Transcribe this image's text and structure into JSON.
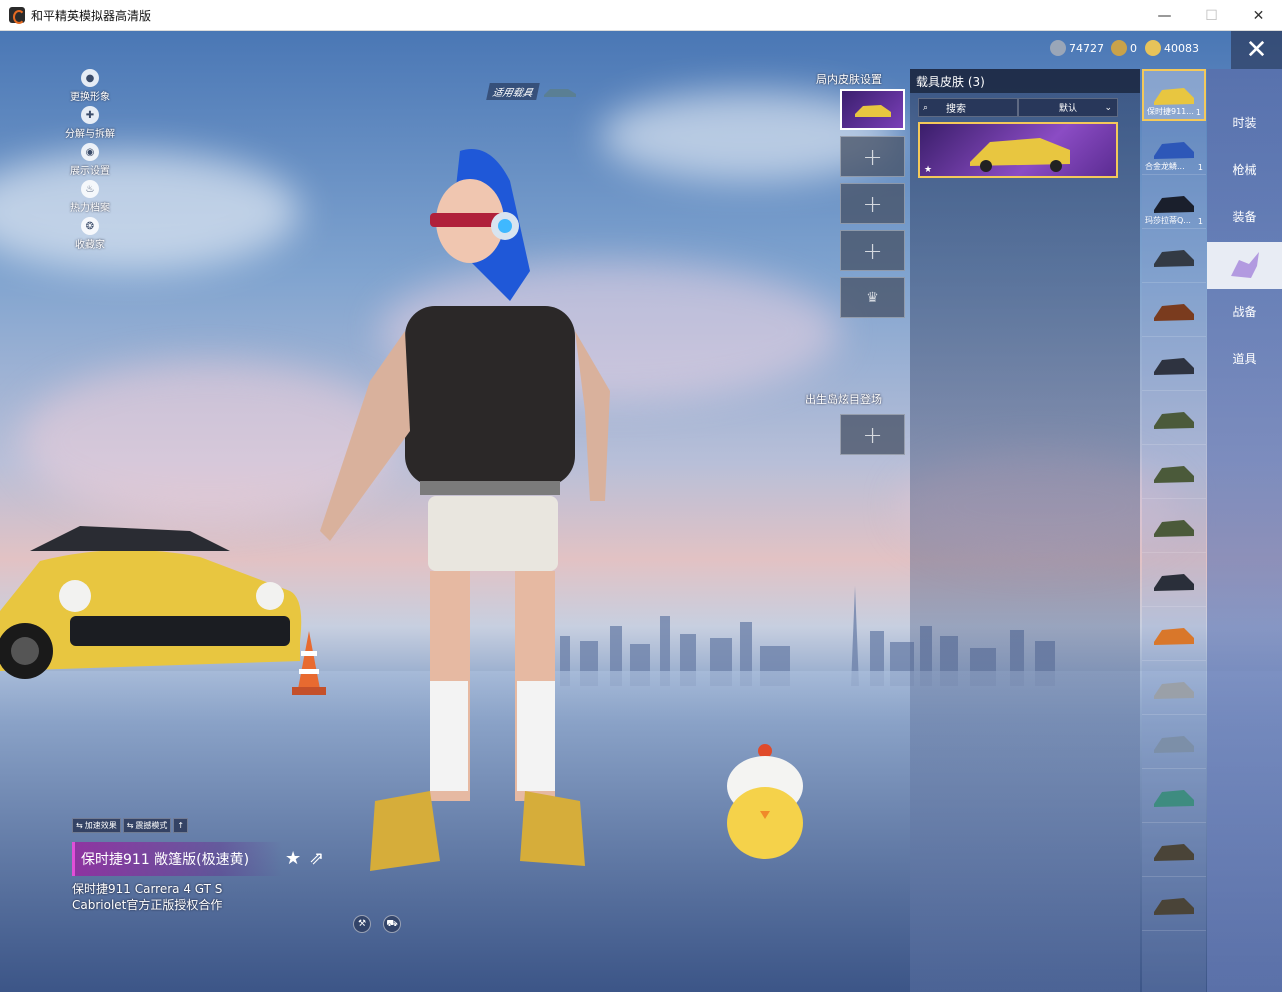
{
  "window": {
    "title": "和平精英模拟器高清版",
    "minimize": "—",
    "maximize": "☐",
    "close": "✕"
  },
  "left_menu": [
    {
      "label": "更换形象",
      "icon": "person-icon",
      "glyph": "●"
    },
    {
      "label": "分解与拆解",
      "icon": "puzzle-icon",
      "glyph": "✚"
    },
    {
      "label": "展示设置",
      "icon": "eye-icon",
      "glyph": "◉"
    },
    {
      "label": "热力档案",
      "icon": "flame-icon",
      "glyph": "♨"
    },
    {
      "label": "收藏家",
      "icon": "collector-badge-icon",
      "glyph": "❂"
    }
  ],
  "currency": [
    {
      "value": "74727",
      "icon": "silver-coin-icon",
      "color": "#9aa6b8"
    },
    {
      "value": "0",
      "icon": "gold-medal-icon",
      "color": "#c9a24a"
    },
    {
      "value": "40083",
      "icon": "diamond-coin-icon",
      "color": "#e7c35a"
    }
  ],
  "apply_vehicle_label": "适用载具",
  "in_match": {
    "title": "局内皮肤设置",
    "add_glyph": "+"
  },
  "spawn_island": {
    "title": "出生岛炫目登场",
    "add_glyph": "+"
  },
  "skin_panel": {
    "title": "载具皮肤 (3)",
    "search_placeholder": "搜索",
    "sort_label": "默认"
  },
  "vehicle_list": [
    {
      "name": "保时捷911...",
      "count": "1",
      "color": "#e8c640",
      "selected": true
    },
    {
      "name": "合金龙鳞...",
      "count": "1",
      "color": "#2d57b8"
    },
    {
      "name": "玛莎拉蒂Q...",
      "count": "1",
      "color": "#1a1f2c"
    },
    {
      "name": "",
      "count": "",
      "color": "#333a44"
    },
    {
      "name": "",
      "count": "",
      "color": "#7a3b1e"
    },
    {
      "name": "",
      "count": "",
      "color": "#2e3340"
    },
    {
      "name": "",
      "count": "",
      "color": "#4b5a3a"
    },
    {
      "name": "",
      "count": "",
      "color": "#4b5a3a"
    },
    {
      "name": "",
      "count": "",
      "color": "#4b5a3a"
    },
    {
      "name": "",
      "count": "",
      "color": "#2a2f3a"
    },
    {
      "name": "",
      "count": "",
      "color": "#d9772a"
    },
    {
      "name": "",
      "count": "",
      "color": "#9aa0a8"
    },
    {
      "name": "",
      "count": "",
      "color": "#7c8fa8"
    },
    {
      "name": "",
      "count": "",
      "color": "#3e8c80"
    },
    {
      "name": "",
      "count": "",
      "color": "#4a4438"
    },
    {
      "name": "",
      "count": "",
      "color": "#4a4438"
    }
  ],
  "categories": [
    {
      "label": "时装"
    },
    {
      "label": "枪械"
    },
    {
      "label": "装备"
    },
    {
      "label": "",
      "active": true,
      "icon": "pegasus-icon"
    },
    {
      "label": "战备"
    },
    {
      "label": "道具"
    }
  ],
  "vehicle_info": {
    "toggle_boost": "加速效果",
    "toggle_mode": "震撼模式",
    "name": "保时捷911 敞篷版(极速黄)",
    "description": "保时捷911 Carrera 4 GT S Cabriolet官方正版授权合作"
  },
  "colors": {
    "accent_gold": "#f4c95a",
    "accent_purple": "#8b4cc4",
    "highlight_pink": "#e04fd8"
  }
}
